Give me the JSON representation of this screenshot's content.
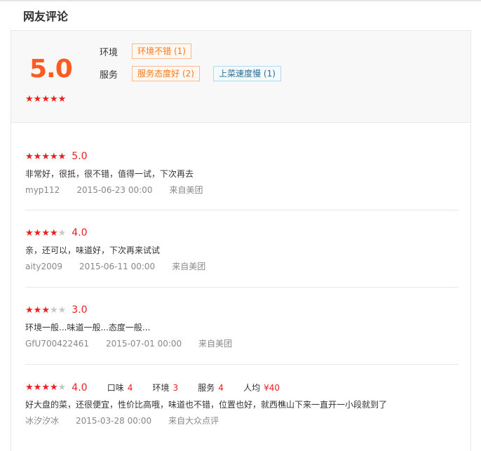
{
  "section": {
    "title": "网友评论"
  },
  "summary": {
    "score": "5.0",
    "stars": 5,
    "rows": [
      {
        "label": "环境",
        "tags": [
          {
            "text": "环境不错 (1)",
            "type": "pos"
          }
        ]
      },
      {
        "label": "服务",
        "tags": [
          {
            "text": "服务态度好 (2)",
            "type": "pos"
          },
          {
            "text": "上菜速度慢 (1)",
            "type": "neg"
          }
        ]
      }
    ]
  },
  "reviews": [
    {
      "stars": 5,
      "score": "5.0",
      "text": "非常好，很抵，很不错，值得一试，下次再去",
      "user": "myp112",
      "time": "2015-06-23 00:00",
      "source": "来自美团"
    },
    {
      "stars": 4,
      "score": "4.0",
      "text": "亲，还可以，味道好，下次再来试试",
      "user": "aity2009",
      "time": "2015-06-11 00:00",
      "source": "来自美团"
    },
    {
      "stars": 3,
      "score": "3.0",
      "text": "环境一般...味道一般...态度一般...",
      "user": "GfU700422461",
      "time": "2015-07-01 00:00",
      "source": "来自美团"
    },
    {
      "stars": 4,
      "score": "4.0",
      "sub": [
        {
          "label": "口味",
          "value": "4"
        },
        {
          "label": "环境",
          "value": "3"
        },
        {
          "label": "服务",
          "value": "4"
        },
        {
          "label": "人均",
          "value": "¥40"
        }
      ],
      "text": "好大盘的菜，还很便宜，性价比高哦，味道也不错，位置也好，就西樵山下来一直开一小段就到了",
      "user": "冰汐汐冰",
      "time": "2015-03-28 00:00",
      "source": "来自大众点评"
    }
  ],
  "colors": {
    "accent": "#ff5a1f",
    "star": "#ea1f1f",
    "star_off": "#c8c8c8",
    "tag_pos": "#f5781e",
    "tag_neg": "#2a6e92"
  },
  "icons": {
    "star": "star-icon"
  }
}
